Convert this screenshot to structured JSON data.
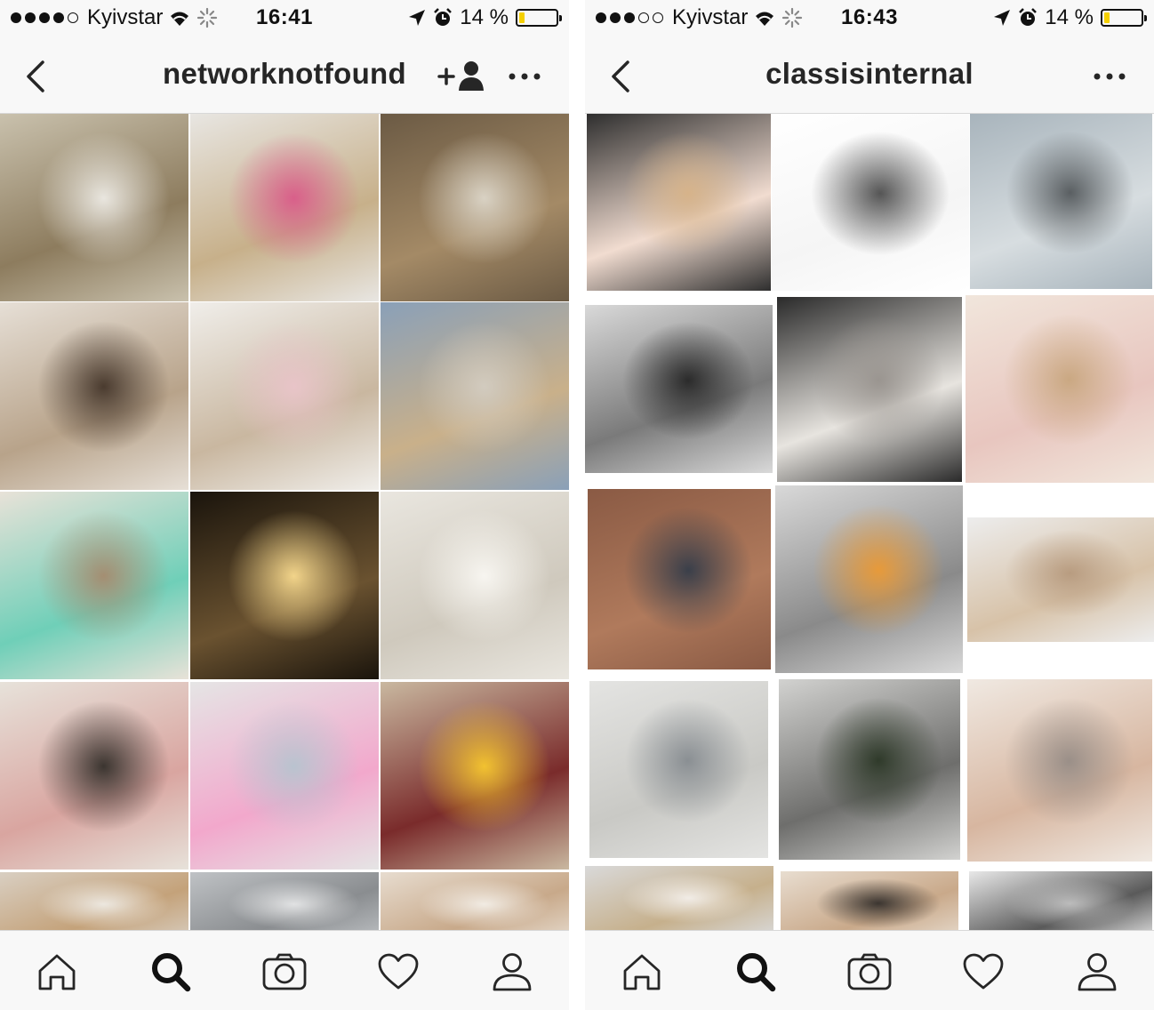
{
  "screens": [
    {
      "status": {
        "carrier": "Kyivstar",
        "time": "16:41",
        "battery": "14 %",
        "battery_level": 0.14,
        "signal_bars": 4
      },
      "nav": {
        "title": "networknotfound",
        "has_follow_icon": true
      },
      "tabs": [
        "home-icon",
        "search-icon",
        "camera-icon",
        "heart-icon",
        "profile-icon"
      ],
      "active_tab": "search-icon"
    },
    {
      "status": {
        "carrier": "Kyivstar",
        "time": "16:43",
        "battery": "14 %",
        "battery_level": 0.14,
        "signal_bars": 3
      },
      "nav": {
        "title": "classisinternal",
        "has_follow_icon": false
      },
      "tabs": [
        "home-icon",
        "search-icon",
        "camera-icon",
        "heart-icon",
        "profile-icon"
      ],
      "active_tab": "search-icon"
    }
  ],
  "colors": {
    "bar_background": "#f8f8f8",
    "separator": "#d8d8d8",
    "battery_fill": "#f5d000",
    "icon": "#262626"
  },
  "photos": {
    "left": [
      {
        "name": "photo-building-facade",
        "colors": [
          "#c9c1ad",
          "#8d7c5e",
          "#e9e6df"
        ]
      },
      {
        "name": "photo-girl-with-roses",
        "colors": [
          "#e8e6e2",
          "#c7b08a",
          "#d95f8a"
        ]
      },
      {
        "name": "photo-museum-statue",
        "colors": [
          "#6b5a44",
          "#a48a66",
          "#d9d2c4"
        ]
      },
      {
        "name": "photo-selfie-red-lips",
        "colors": [
          "#e6dfd6",
          "#b8a38a",
          "#4a3b2f"
        ]
      },
      {
        "name": "photo-milkshakes-table",
        "colors": [
          "#f0eeea",
          "#c9b7a0",
          "#e8c4c8"
        ]
      },
      {
        "name": "photo-girl-sunglasses-denim",
        "colors": [
          "#8aa0b8",
          "#c9b08a",
          "#d2cbbf"
        ]
      },
      {
        "name": "photo-cafe-table-top",
        "colors": [
          "#e8e2d8",
          "#6fcfb8",
          "#a48e72"
        ]
      },
      {
        "name": "photo-lit-building-night",
        "colors": [
          "#1a140c",
          "#6a5230",
          "#f2d48a"
        ]
      },
      {
        "name": "photo-white-roses",
        "colors": [
          "#e9e6df",
          "#cfc9bd",
          "#f7f5f0"
        ]
      },
      {
        "name": "photo-phone-sunglasses",
        "colors": [
          "#e7e2da",
          "#d9a5a0",
          "#3b3530"
        ]
      },
      {
        "name": "photo-cotton-candy",
        "colors": [
          "#e5e5e5",
          "#f2a8cc",
          "#b9c3cf"
        ]
      },
      {
        "name": "photo-street-taxi",
        "colors": [
          "#c9b8a0",
          "#7a2b2b",
          "#f2c230"
        ]
      },
      {
        "name": "photo-partial-selfie",
        "colors": [
          "#d9cfc2",
          "#c4a27a",
          "#ece7df"
        ]
      },
      {
        "name": "photo-partial-mall",
        "colors": [
          "#bfc2c5",
          "#8a8d90",
          "#e1e2e3"
        ]
      },
      {
        "name": "photo-partial-face",
        "colors": [
          "#e7dccf",
          "#c8a98a",
          "#f1ebe3"
        ]
      }
    ],
    "right": [
      {
        "name": "photo-mdma-sweater",
        "colors": [
          "#2e2e2e",
          "#f1dcd0",
          "#d6b38a"
        ]
      },
      {
        "name": "photo-poem-text",
        "colors": [
          "#ffffff",
          "#f5f5f5",
          "#555555"
        ]
      },
      {
        "name": "photo-sea-rock",
        "colors": [
          "#a8b4bc",
          "#d7dde0",
          "#5a5f62"
        ]
      },
      {
        "name": "photo-bw-desert-hat",
        "colors": [
          "#d9d9d9",
          "#7a7a7a",
          "#2b2b2b"
        ]
      },
      {
        "name": "photo-white-sneakers",
        "colors": [
          "#2a2a2a",
          "#e7e4df",
          "#9a9590"
        ]
      },
      {
        "name": "photo-magazine-kitten",
        "colors": [
          "#f1e6dc",
          "#e8c6bf",
          "#caa882"
        ]
      },
      {
        "name": "photo-brick-wall-girl",
        "colors": [
          "#8a5a44",
          "#b07a5c",
          "#3a3f4a"
        ]
      },
      {
        "name": "photo-magazine-collage",
        "colors": [
          "#d9d9d9",
          "#8a8a8a",
          "#e79a3a"
        ]
      },
      {
        "name": "photo-lying-girl",
        "colors": [
          "#ededed",
          "#d7c2a8",
          "#b89c80"
        ]
      },
      {
        "name": "photo-hat-lace-dress",
        "colors": [
          "#e4e4e2",
          "#c9c9c5",
          "#8a8f93"
        ]
      },
      {
        "name": "photo-building-tree",
        "colors": [
          "#d2d2d0",
          "#6e6e6c",
          "#2f3a2a"
        ]
      },
      {
        "name": "photo-magazine-spread",
        "colors": [
          "#f0e9e2",
          "#d7b6a0",
          "#9a8f88"
        ]
      },
      {
        "name": "photo-partial-portrait",
        "colors": [
          "#d9d9d9",
          "#c6b08c",
          "#f1ece6"
        ]
      },
      {
        "name": "photo-partial-closeup",
        "colors": [
          "#e8ddd0",
          "#c9a98a",
          "#3b3530"
        ]
      },
      {
        "name": "photo-partial-palms",
        "colors": [
          "#e8e8e8",
          "#5a5a5a",
          "#bcbcbc"
        ]
      }
    ]
  }
}
